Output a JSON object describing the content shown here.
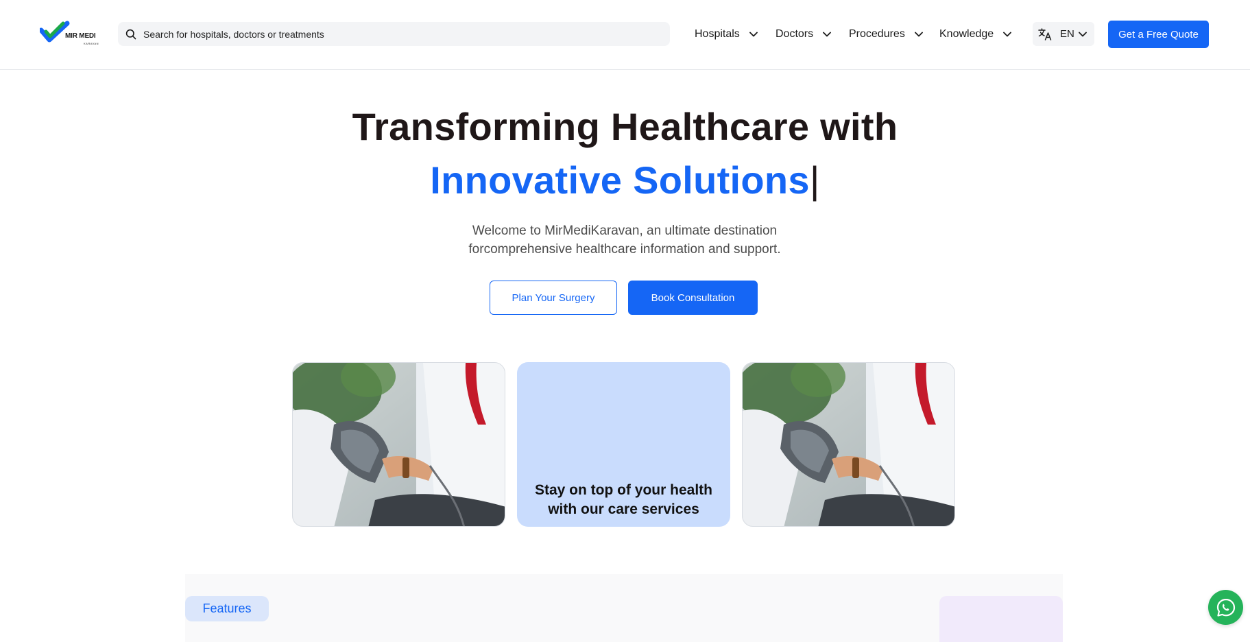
{
  "brand": {
    "logo_text": "MIR MEDI",
    "logo_subtext": "KARAVAN",
    "primary_color": "#1566f5",
    "logo_green": "#1aa84a"
  },
  "header": {
    "search_placeholder": "Search for hospitals, doctors or treatments",
    "nav": [
      {
        "label": "Hospitals"
      },
      {
        "label": "Doctors"
      },
      {
        "label": "Procedures"
      },
      {
        "label": "Knowledge"
      }
    ],
    "language": {
      "icon": "translate-icon",
      "code": "EN"
    },
    "cta_label": "Get a Free Quote"
  },
  "hero": {
    "line1": "Transforming Healthcare with",
    "line2": "Innovative Solutions",
    "cursor": "|",
    "subtitle_line1": "Welcome to MirMediKaravan, an ultimate destination",
    "subtitle_line2": "forcomprehensive healthcare information and support.",
    "btn_plan": "Plan Your Surgery",
    "btn_book": "Book Consultation"
  },
  "cards": {
    "middle_line1": "Stay on top of your health",
    "middle_line2": "with our care services",
    "middle_bg": "#c9dcfd"
  },
  "features": {
    "pill_label": "Features"
  },
  "floating": {
    "whatsapp_icon": "whatsapp-icon",
    "whatsapp_color": "#25b35a"
  }
}
